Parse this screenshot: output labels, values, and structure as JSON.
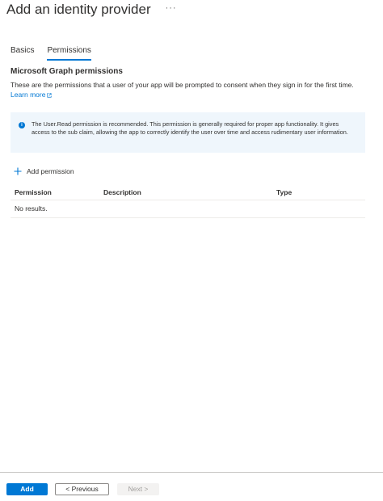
{
  "header": {
    "title": "Add an identity provider",
    "more": "···"
  },
  "tabs": [
    {
      "label": "Basics",
      "active": false
    },
    {
      "label": "Permissions",
      "active": true
    }
  ],
  "section": {
    "title": "Microsoft Graph permissions",
    "description": "These are the permissions that a user of your app will be prompted to consent when they sign in for the first time.",
    "learn_more": "Learn more"
  },
  "info": {
    "text": "The User.Read permission is recommended. This permission is generally required for proper app functionality. It gives access to the sub claim, allowing the app to correctly identify the user over time and access rudimentary user information."
  },
  "add_permission": "Add permission",
  "table": {
    "columns": [
      "Permission",
      "Description",
      "Type"
    ],
    "empty_text": "No results."
  },
  "footer": {
    "add": "Add",
    "previous": "< Previous",
    "next": "Next >"
  },
  "colors": {
    "accent": "#0078d4",
    "info_bg": "#eff6fc"
  }
}
